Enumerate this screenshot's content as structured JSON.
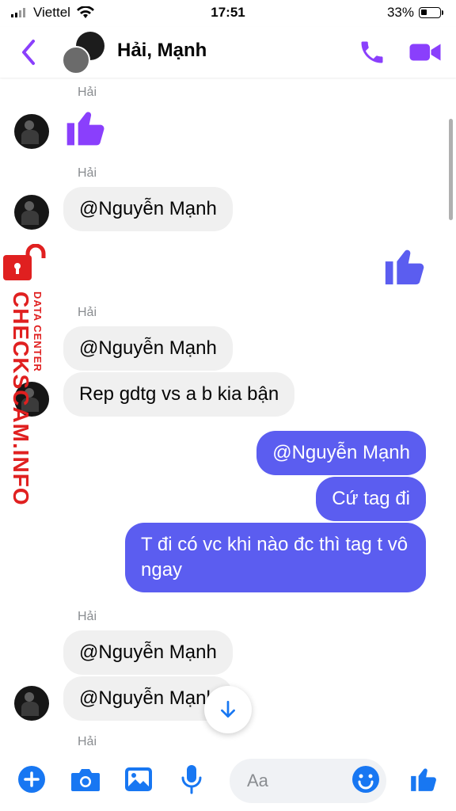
{
  "status_bar": {
    "carrier": "Viettel",
    "time": "17:51",
    "battery": "33%"
  },
  "header": {
    "title": "Hải, Mạnh"
  },
  "colors": {
    "accent": "#5b5df0",
    "icon_purple": "#8a3ffc",
    "bubble_in": "#f0f0f0"
  },
  "messages": [
    {
      "sender": "Hải",
      "type": "like"
    },
    {
      "sender": "Hải",
      "text": "@Nguyễn Mạnh"
    },
    {
      "sender": "me",
      "type": "like"
    },
    {
      "sender": "Hải",
      "text": "@Nguyễn Mạnh"
    },
    {
      "sender": "Hải",
      "text": "Rep gdtg vs a b kia bận"
    },
    {
      "sender": "me",
      "text": "@Nguyễn Mạnh"
    },
    {
      "sender": "me",
      "text": "Cứ tag đi"
    },
    {
      "sender": "me",
      "text": "T đi có vc khi nào đc thì tag t vô ngay"
    },
    {
      "sender": "Hải",
      "text": "@Nguyễn Mạnh"
    },
    {
      "sender": "Hải",
      "text": "@Nguyễn Mạnh"
    }
  ],
  "sender_labels": [
    "Hải",
    "Hải",
    "Hải",
    "Hải",
    "Hải"
  ],
  "watermark": {
    "title": "CHECKSCAM.INFO",
    "subtitle": "DATA CENTER"
  },
  "composer": {
    "placeholder": "Aa"
  },
  "icons": [
    "back-arrow",
    "phone",
    "video-camera",
    "plus",
    "camera",
    "gallery",
    "microphone",
    "emoji",
    "thumbs-up",
    "arrow-down"
  ]
}
